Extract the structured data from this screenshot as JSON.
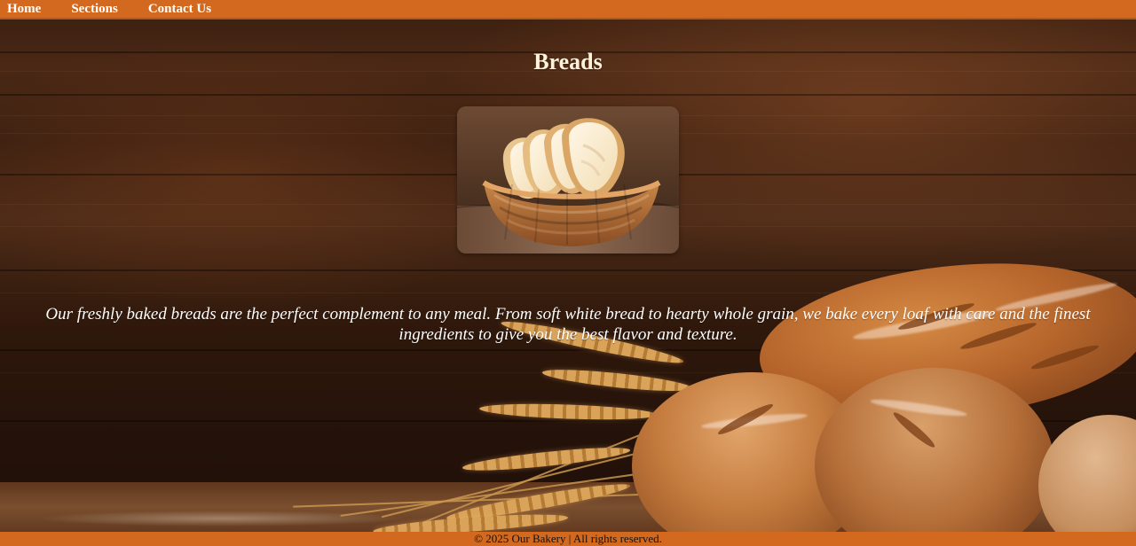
{
  "nav": {
    "items": [
      {
        "label": "Home"
      },
      {
        "label": "Sections"
      },
      {
        "label": "Contact Us"
      }
    ]
  },
  "page": {
    "title": "Breads",
    "description": "Our freshly baked breads are the perfect complement to any meal. From soft white bread to hearty whole grain, we bake every loaf with care and the finest ingredients to give you the best flavor and texture."
  },
  "footer": {
    "text": "© 2025 Our Bakery | All rights reserved."
  },
  "colors": {
    "nav_background": "#d2691e",
    "footer_background": "#d2691e",
    "title_text": "#fff3dc",
    "body_text": "#ffffff"
  }
}
